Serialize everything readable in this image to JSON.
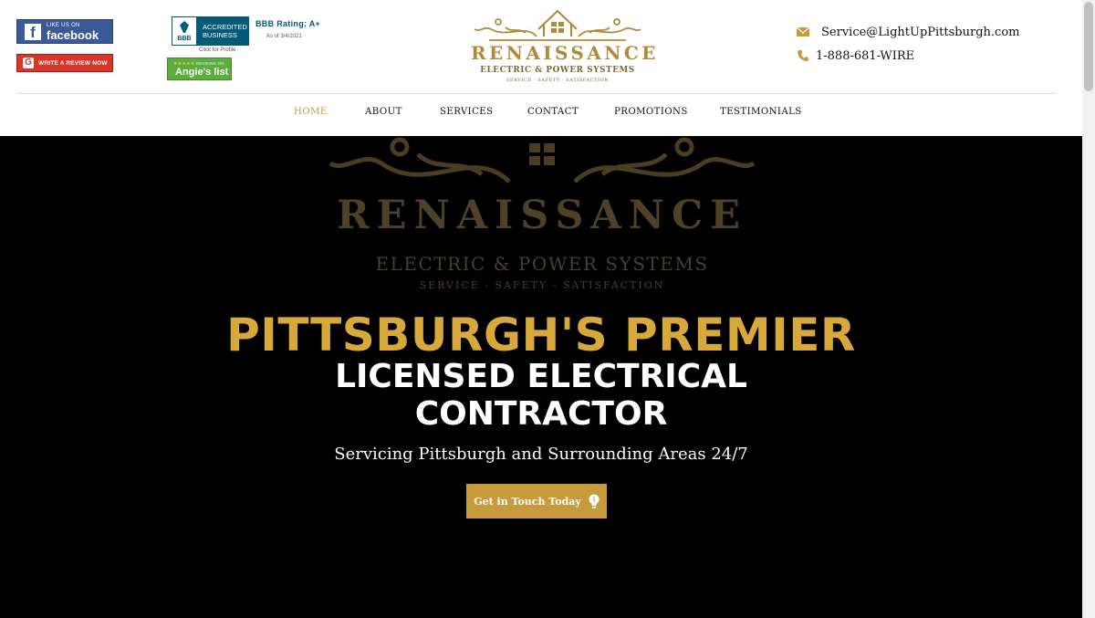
{
  "header": {
    "facebook": {
      "small": "LIKE US ON",
      "big": "facebook",
      "icon": "facebook-f-icon",
      "color": "#3b5998"
    },
    "google_review": {
      "label": "WRITE A REVIEW NOW",
      "icon": "google-icon",
      "color": "#d9362a"
    },
    "bbb": {
      "logo": "BBB",
      "accredited": "ACCREDITED BUSINESS",
      "rating": "BBB Rating: A+",
      "date": "As of 3/4/2021",
      "click": "Click for Profile",
      "color": "#005a78"
    },
    "angies": {
      "top": "REVIEWS ON",
      "name": "Angie's list",
      "color": "#5aad3e"
    },
    "logo": {
      "name": "RENAISSANCE",
      "subtitle": "ELECTRIC & POWER SYSTEMS",
      "tagline": "SERVICE · SAFETY · SATISFACTION"
    },
    "contact": {
      "email": "Service@LightUpPittsburgh.com",
      "phone": "1-888-681-WIRE",
      "email_icon": "envelope-icon",
      "phone_icon": "phone-icon"
    }
  },
  "nav": {
    "items": [
      {
        "label": "HOME",
        "active": true
      },
      {
        "label": "ABOUT",
        "active": false
      },
      {
        "label": "SERVICES",
        "active": false
      },
      {
        "label": "CONTACT",
        "active": false
      },
      {
        "label": "PROMOTIONS",
        "active": false
      },
      {
        "label": "TESTIMONIALS",
        "active": false
      }
    ],
    "active_color": "#c49a3c"
  },
  "hero": {
    "logo_name": "RENAISSANCE",
    "logo_subtitle": "ELECTRIC & POWER SYSTEMS",
    "logo_tagline": "SERVICE - SAFETY - SATISFACTION",
    "headline": "PITTSBURGH'S PREMIER",
    "subhead_line1": "LICENSED ELECTRICAL",
    "subhead_line2": "CONTRACTOR",
    "tagline": "Servicing Pittsburgh and Surrounding Areas 24/7",
    "cta_label": "Get in Touch Today",
    "cta_icon": "lightbulb-icon",
    "headline_color": "#d6a93a",
    "cta_color": "#c79a3c"
  }
}
